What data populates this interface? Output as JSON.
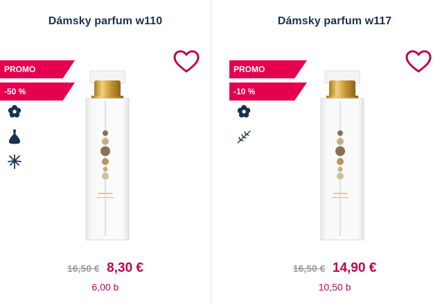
{
  "products": [
    {
      "title": "Dámsky parfum w110",
      "badges": {
        "promo": "PROMO",
        "discount": "-50 %"
      },
      "old_price": "16,50 €",
      "new_price": "8,30 €",
      "points": "6,00 b",
      "features": [
        "flower-icon",
        "perfume-drop-icon",
        "palm-icon"
      ]
    },
    {
      "title": "Dámsky parfum w117",
      "badges": {
        "promo": "PROMO",
        "discount": "-10 %"
      },
      "old_price": "16,50 €",
      "new_price": "14,90 €",
      "points": "10,50 b",
      "features": [
        "flower-icon",
        "branch-icon"
      ]
    }
  ],
  "colors": {
    "accent": "#e5004f",
    "price": "#c4004d",
    "title": "#1b3150",
    "icon": "#1b3150"
  }
}
